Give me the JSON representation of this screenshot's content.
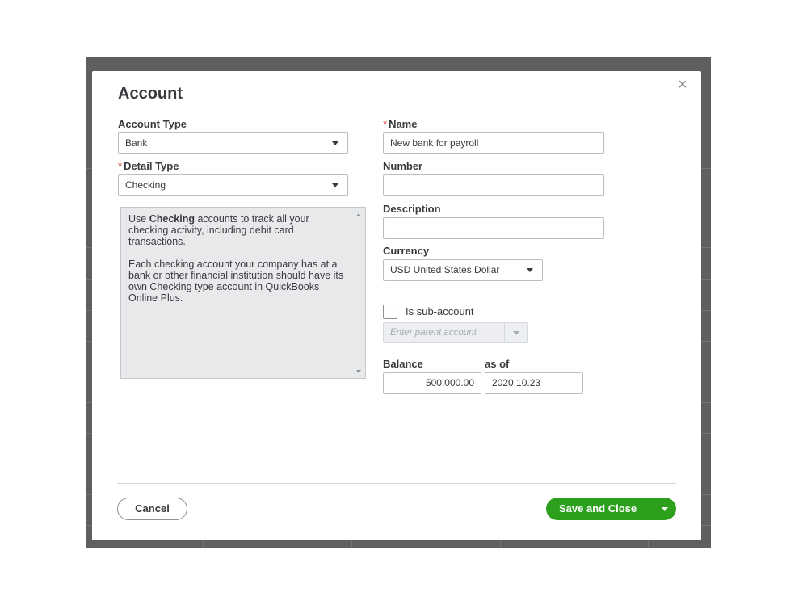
{
  "modal": {
    "title": "Account",
    "close_glyph": "×"
  },
  "left": {
    "account_type": {
      "label": "Account Type",
      "value": "Bank"
    },
    "detail_type": {
      "label": "Detail Type",
      "required_mark": "*",
      "value": "Checking"
    },
    "help": {
      "p1_pre": "Use ",
      "p1_bold": "Checking",
      "p1_post": " accounts to track all your checking activity, including debit card transactions.",
      "p2": "Each checking account your company has at a bank or other financial institution should have its own Checking type account in QuickBooks Online Plus."
    }
  },
  "right": {
    "name": {
      "label": "Name",
      "required_mark": "*",
      "value": "New bank for payroll"
    },
    "number": {
      "label": "Number",
      "value": ""
    },
    "description": {
      "label": "Description",
      "value": ""
    },
    "currency": {
      "label": "Currency",
      "value": "USD United States Dollar"
    },
    "sub_account": {
      "label": "Is sub-account",
      "checked": false,
      "placeholder": "Enter parent account"
    },
    "balance": {
      "label": "Balance",
      "value": "500,000.00"
    },
    "as_of": {
      "label": "as of",
      "value": "2020.10.23"
    }
  },
  "footer": {
    "cancel_label": "Cancel",
    "save_label": "Save and Close"
  },
  "icons": {
    "close": "close-icon",
    "dropdown": "chevron-down-icon"
  },
  "colors": {
    "primary": "#2ca01c",
    "required": "#d52b1e",
    "backdrop": "#5f5f60"
  }
}
